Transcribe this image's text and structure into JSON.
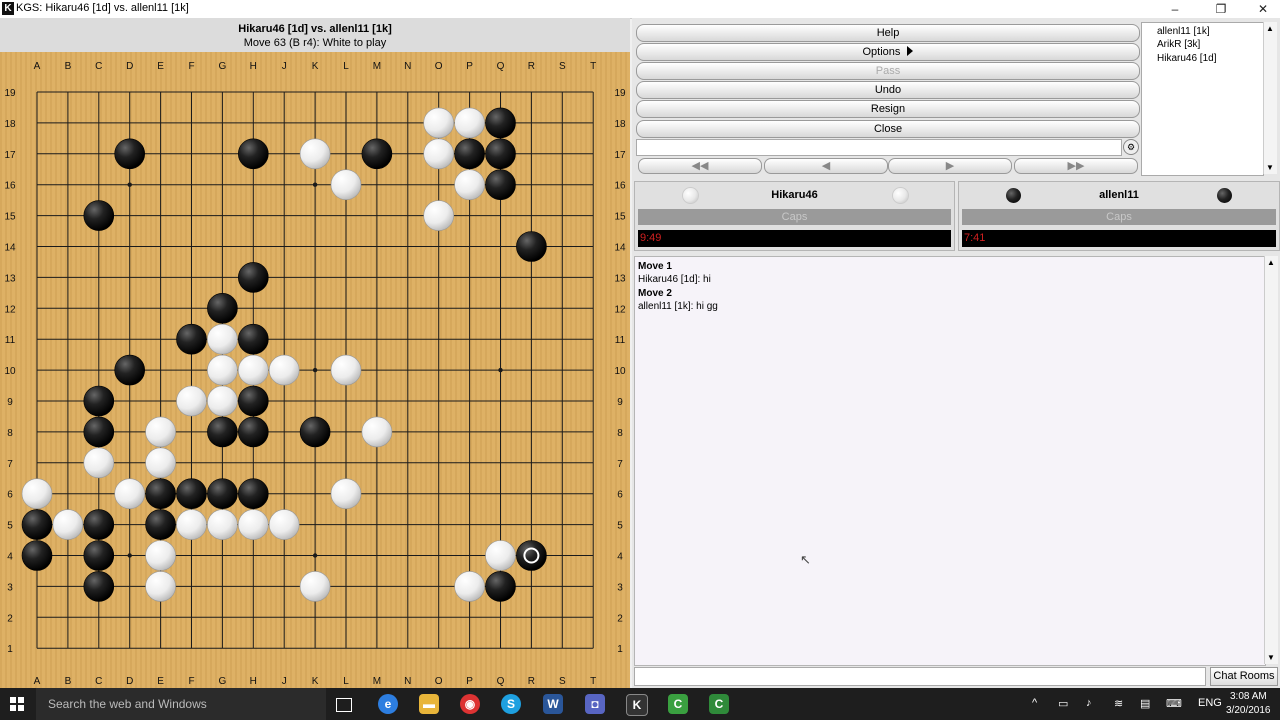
{
  "window": {
    "app_icon": "K",
    "title": "KGS: Hikaru46 [1d] vs. allenl11 [1k]",
    "minimize": "–",
    "maximize": "❐",
    "close": "✕"
  },
  "board_header": {
    "title": "Hikaru46 [1d] vs. allenl11 [1k]",
    "status": "Move 63 (B r4): White to play"
  },
  "board": {
    "letters": [
      "A",
      "B",
      "C",
      "D",
      "E",
      "F",
      "G",
      "H",
      "J",
      "K",
      "L",
      "M",
      "N",
      "O",
      "P",
      "Q",
      "R",
      "S",
      "T"
    ],
    "numbers": [
      19,
      18,
      17,
      16,
      15,
      14,
      13,
      12,
      11,
      10,
      9,
      8,
      7,
      6,
      5,
      4,
      3,
      2,
      1
    ],
    "black_stones": [
      "Q18",
      "D17",
      "H17",
      "M17",
      "P17",
      "Q17",
      "Q16",
      "C15",
      "R14",
      "H13",
      "G12",
      "F11",
      "H11",
      "D10",
      "C9",
      "H9",
      "C8",
      "G8",
      "H8",
      "K8",
      "E6",
      "F6",
      "G6",
      "H6",
      "A5",
      "C5",
      "E5",
      "A4",
      "C4",
      "Q3",
      "C3",
      "R4"
    ],
    "white_stones": [
      "O18",
      "P18",
      "K17",
      "O17",
      "L16",
      "P16",
      "O15",
      "G11",
      "G10",
      "H10",
      "J10",
      "L10",
      "F9",
      "G9",
      "E8",
      "M8",
      "C7",
      "E7",
      "A6",
      "D6",
      "L6",
      "B5",
      "F5",
      "G5",
      "H5",
      "J5",
      "E4",
      "Q4",
      "E3",
      "K3",
      "P3"
    ],
    "last_move": "R4"
  },
  "controls": {
    "help": "Help",
    "options": "Options",
    "pass": "Pass",
    "undo": "Undo",
    "resign": "Resign",
    "close": "Close"
  },
  "users": [
    "allenl11 [1k]",
    "ArikR [3k]",
    "Hikaru46 [1d]"
  ],
  "players": {
    "white": {
      "name": "Hikaru46",
      "caps_label": "Caps",
      "clock": "9:49"
    },
    "black": {
      "name": "allenl11",
      "caps_label": "Caps",
      "clock": "7:41"
    }
  },
  "chat": [
    {
      "text": "Move 1",
      "bold": true
    },
    {
      "text": "Hikaru46 [1d]: hi",
      "bold": false
    },
    {
      "text": "Move 2",
      "bold": true
    },
    {
      "text": "allenl11 [1k]: hi gg",
      "bold": false
    }
  ],
  "chat_rooms_button": "Chat Rooms",
  "taskbar": {
    "search_placeholder": "Search the web and Windows",
    "language": "ENG",
    "time": "3:08 AM",
    "date": "3/20/2016"
  }
}
